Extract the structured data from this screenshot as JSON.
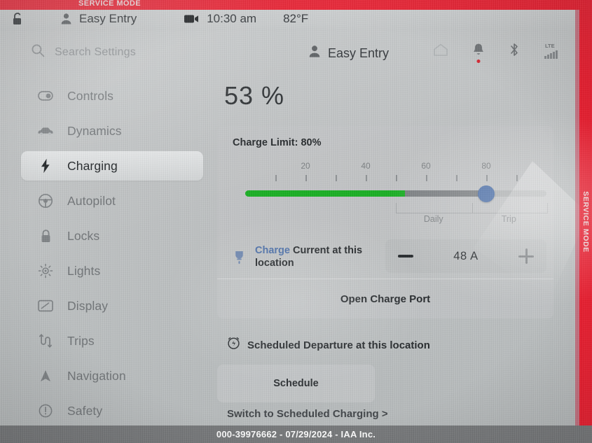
{
  "overlay": {
    "service_mode_top": "SERVICE MODE",
    "service_mode_side": "SERVICE MODE",
    "watermark": "000-39976662 - 07/29/2024 - IAA Inc.",
    "red_hex": "#ec1c2e"
  },
  "car_status_bar": {
    "lock_icon": "unlocked-padlock-icon",
    "profile_icon": "person-icon",
    "profile_name": "Easy Entry",
    "camera_icon": "video-camera-icon",
    "time": "10:30 am",
    "temperature": "82°F"
  },
  "app_header": {
    "profile_icon": "person-icon",
    "profile_name": "Easy Entry",
    "home_icon": "home-icon",
    "bell_icon": "bell-icon",
    "bell_has_alert": true,
    "bluetooth_icon": "bluetooth-icon",
    "signal_label": "LTE"
  },
  "search": {
    "icon": "search-icon",
    "placeholder": "Search Settings",
    "value": ""
  },
  "sidebar": {
    "items": [
      {
        "label": "Controls",
        "icon": "toggle-icon",
        "selected": false
      },
      {
        "label": "Dynamics",
        "icon": "car-icon",
        "selected": false
      },
      {
        "label": "Charging",
        "icon": "bolt-icon",
        "selected": true
      },
      {
        "label": "Autopilot",
        "icon": "steering-wheel-icon",
        "selected": false
      },
      {
        "label": "Locks",
        "icon": "lock-icon",
        "selected": false
      },
      {
        "label": "Lights",
        "icon": "sun-icon",
        "selected": false
      },
      {
        "label": "Display",
        "icon": "display-icon",
        "selected": false
      },
      {
        "label": "Trips",
        "icon": "trips-icon",
        "selected": false
      },
      {
        "label": "Navigation",
        "icon": "navigation-arrow-icon",
        "selected": false
      },
      {
        "label": "Safety",
        "icon": "alert-circle-icon",
        "selected": false
      }
    ]
  },
  "charging": {
    "battery_percent_text": "53 %",
    "battery_percent": 53,
    "charge_limit_label": "Charge Limit: 80%",
    "charge_limit_percent": 80,
    "slider": {
      "min": 0,
      "max": 100,
      "tick_step": 10,
      "tick_labels": [
        "20",
        "40",
        "60",
        "80"
      ],
      "tick_label_values": [
        20,
        40,
        60,
        80
      ],
      "green_fill_to": 53,
      "gray_fill_to": 80,
      "knob_at": 80,
      "green_hex": "#18b022",
      "gray_hex": "#7b7f82",
      "knob_hex": "#4a6ea8",
      "mode_daily": "Daily",
      "mode_trip": "Trip",
      "mode_bracket_from": 50,
      "mode_bracket_to": 100
    },
    "charge_current": {
      "icon": "plug-icon",
      "label_accent": "Charge",
      "label_rest": " Current at this location",
      "value": "48 A",
      "amps": 48,
      "minus_label": "−",
      "plus_label": "+"
    },
    "open_charge_port": "Open Charge Port",
    "scheduled_departure": {
      "icon": "alarm-clock-icon",
      "label": "Scheduled Departure at this location",
      "schedule_button": "Schedule",
      "switch_link": "Switch to Scheduled Charging >"
    }
  }
}
